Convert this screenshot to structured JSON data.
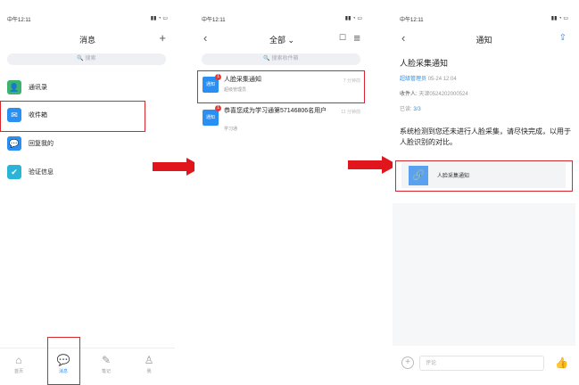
{
  "screen1": {
    "status_time": "中午12:11",
    "status_icons": "▮▮ ◔ ▭",
    "title": "消息",
    "add_icon": "+",
    "search_placeholder": "🔍 搜索",
    "items": [
      {
        "label": "通讯录",
        "icon": "contacts-icon",
        "glyph": "👤",
        "color": "#3cb371"
      },
      {
        "label": "收件箱",
        "icon": "inbox-icon",
        "glyph": "✉",
        "color": "#2a8ff2"
      },
      {
        "label": "回复我的",
        "icon": "reply-icon",
        "glyph": "💬",
        "color": "#2a8ff2"
      },
      {
        "label": "验证信息",
        "icon": "verify-icon",
        "glyph": "✔",
        "color": "#2ab5d8"
      }
    ],
    "tabs": [
      {
        "label": "首页",
        "icon": "home-icon",
        "glyph": "⌂"
      },
      {
        "label": "消息",
        "icon": "message-icon",
        "glyph": "💬"
      },
      {
        "label": "笔记",
        "icon": "note-icon",
        "glyph": "✎"
      },
      {
        "label": "我",
        "icon": "profile-icon",
        "glyph": "♙"
      }
    ]
  },
  "screen2": {
    "status_time": "中午12:11",
    "status_icons": "▮▮ ◔ ▭",
    "back": "‹",
    "title": "全部 ⌄",
    "edit_icon": "☐",
    "menu_icon": "≡",
    "search_placeholder": "🔍 搜索收件箱",
    "messages": [
      {
        "avatar": "通知",
        "badge": "1",
        "title": "人脸采集通知",
        "sub": "超级管理员",
        "time": "7 分钟前"
      },
      {
        "avatar": "通知",
        "badge": "1",
        "title": "恭喜您成为学习通第57146806名用户",
        "sub": "学习通",
        "time": "11 分钟前"
      }
    ]
  },
  "screen3": {
    "status_time": "中午12:11",
    "status_icons": "▮▮ ◔ ▭",
    "back": "‹",
    "title": "通知",
    "share_icon": "⇪",
    "notice_title": "人脸采集通知",
    "sender": "超级管理员",
    "sent_time": "05-24 12:04",
    "recipient_label": "收件人:",
    "recipient": "天津0524202000524",
    "read_label": "已读:",
    "read_count": "3/3",
    "body": "系统检测到您还未进行人脸采集，请尽快完成，以用于人脸识别的对比。",
    "attachment_icon": "🔗",
    "attachment_label": "人脸采集通知",
    "comment_plus": "+",
    "comment_placeholder": "评论",
    "like_icon": "👍"
  },
  "colors": {
    "accent": "#2a8ff2",
    "highlight": "#d9262c",
    "arrow": "#e0161c"
  }
}
